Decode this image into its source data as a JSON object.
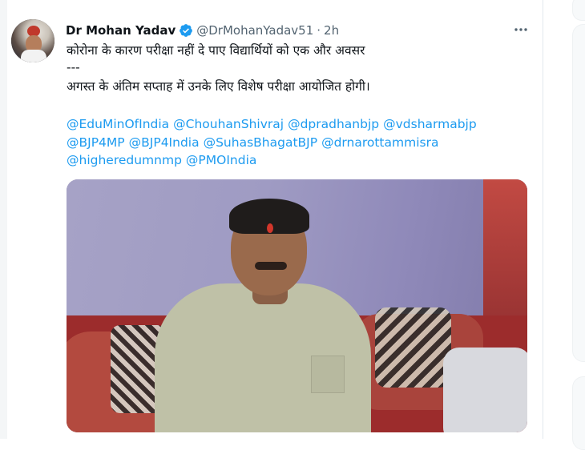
{
  "tweet": {
    "author_name": "Dr Mohan Yadav",
    "handle": "@DrMohanYadav51",
    "separator": "·",
    "time": "2h",
    "lines": [
      "कोरोना के कारण परीक्षा नहीं दे पाए विद्यार्थियों को एक और अवसर",
      "---",
      "अगस्त के अंतिम सप्ताह में उनके लिए विशेष परीक्षा आयोजित होगी।"
    ],
    "mentions_line1": [
      "@EduMinOfIndia",
      "@ChouhanShivraj",
      "@dpradhanbjp",
      "@vdsharmabjp"
    ],
    "mentions_line2": [
      "@BJP4MP",
      "@BJP4India",
      "@SuhasBhagatBJP",
      "@drnarottammisra"
    ],
    "mentions_line3": [
      "@higheredumnmp",
      "@PMOIndia"
    ]
  },
  "icons": {
    "verified": "verified-badge-icon",
    "more": "more-dots-icon"
  },
  "colors": {
    "link": "#1d9bf0",
    "verified": "#1d9bf0",
    "secondary_text": "#536471"
  }
}
